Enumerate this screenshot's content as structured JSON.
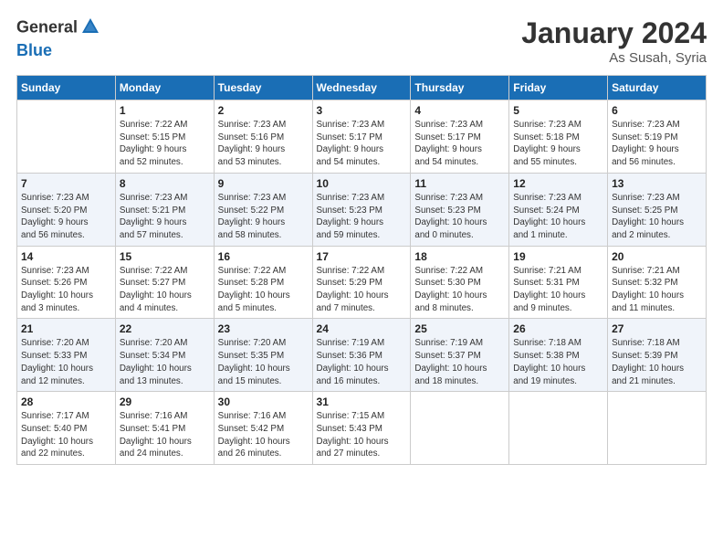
{
  "header": {
    "logo_general": "General",
    "logo_blue": "Blue",
    "month": "January 2024",
    "location": "As Susah, Syria"
  },
  "weekdays": [
    "Sunday",
    "Monday",
    "Tuesday",
    "Wednesday",
    "Thursday",
    "Friday",
    "Saturday"
  ],
  "weeks": [
    [
      {
        "day": "",
        "info": ""
      },
      {
        "day": "1",
        "info": "Sunrise: 7:22 AM\nSunset: 5:15 PM\nDaylight: 9 hours\nand 52 minutes."
      },
      {
        "day": "2",
        "info": "Sunrise: 7:23 AM\nSunset: 5:16 PM\nDaylight: 9 hours\nand 53 minutes."
      },
      {
        "day": "3",
        "info": "Sunrise: 7:23 AM\nSunset: 5:17 PM\nDaylight: 9 hours\nand 54 minutes."
      },
      {
        "day": "4",
        "info": "Sunrise: 7:23 AM\nSunset: 5:17 PM\nDaylight: 9 hours\nand 54 minutes."
      },
      {
        "day": "5",
        "info": "Sunrise: 7:23 AM\nSunset: 5:18 PM\nDaylight: 9 hours\nand 55 minutes."
      },
      {
        "day": "6",
        "info": "Sunrise: 7:23 AM\nSunset: 5:19 PM\nDaylight: 9 hours\nand 56 minutes."
      }
    ],
    [
      {
        "day": "7",
        "info": "Sunrise: 7:23 AM\nSunset: 5:20 PM\nDaylight: 9 hours\nand 56 minutes."
      },
      {
        "day": "8",
        "info": "Sunrise: 7:23 AM\nSunset: 5:21 PM\nDaylight: 9 hours\nand 57 minutes."
      },
      {
        "day": "9",
        "info": "Sunrise: 7:23 AM\nSunset: 5:22 PM\nDaylight: 9 hours\nand 58 minutes."
      },
      {
        "day": "10",
        "info": "Sunrise: 7:23 AM\nSunset: 5:23 PM\nDaylight: 9 hours\nand 59 minutes."
      },
      {
        "day": "11",
        "info": "Sunrise: 7:23 AM\nSunset: 5:23 PM\nDaylight: 10 hours\nand 0 minutes."
      },
      {
        "day": "12",
        "info": "Sunrise: 7:23 AM\nSunset: 5:24 PM\nDaylight: 10 hours\nand 1 minute."
      },
      {
        "day": "13",
        "info": "Sunrise: 7:23 AM\nSunset: 5:25 PM\nDaylight: 10 hours\nand 2 minutes."
      }
    ],
    [
      {
        "day": "14",
        "info": "Sunrise: 7:23 AM\nSunset: 5:26 PM\nDaylight: 10 hours\nand 3 minutes."
      },
      {
        "day": "15",
        "info": "Sunrise: 7:22 AM\nSunset: 5:27 PM\nDaylight: 10 hours\nand 4 minutes."
      },
      {
        "day": "16",
        "info": "Sunrise: 7:22 AM\nSunset: 5:28 PM\nDaylight: 10 hours\nand 5 minutes."
      },
      {
        "day": "17",
        "info": "Sunrise: 7:22 AM\nSunset: 5:29 PM\nDaylight: 10 hours\nand 7 minutes."
      },
      {
        "day": "18",
        "info": "Sunrise: 7:22 AM\nSunset: 5:30 PM\nDaylight: 10 hours\nand 8 minutes."
      },
      {
        "day": "19",
        "info": "Sunrise: 7:21 AM\nSunset: 5:31 PM\nDaylight: 10 hours\nand 9 minutes."
      },
      {
        "day": "20",
        "info": "Sunrise: 7:21 AM\nSunset: 5:32 PM\nDaylight: 10 hours\nand 11 minutes."
      }
    ],
    [
      {
        "day": "21",
        "info": "Sunrise: 7:20 AM\nSunset: 5:33 PM\nDaylight: 10 hours\nand 12 minutes."
      },
      {
        "day": "22",
        "info": "Sunrise: 7:20 AM\nSunset: 5:34 PM\nDaylight: 10 hours\nand 13 minutes."
      },
      {
        "day": "23",
        "info": "Sunrise: 7:20 AM\nSunset: 5:35 PM\nDaylight: 10 hours\nand 15 minutes."
      },
      {
        "day": "24",
        "info": "Sunrise: 7:19 AM\nSunset: 5:36 PM\nDaylight: 10 hours\nand 16 minutes."
      },
      {
        "day": "25",
        "info": "Sunrise: 7:19 AM\nSunset: 5:37 PM\nDaylight: 10 hours\nand 18 minutes."
      },
      {
        "day": "26",
        "info": "Sunrise: 7:18 AM\nSunset: 5:38 PM\nDaylight: 10 hours\nand 19 minutes."
      },
      {
        "day": "27",
        "info": "Sunrise: 7:18 AM\nSunset: 5:39 PM\nDaylight: 10 hours\nand 21 minutes."
      }
    ],
    [
      {
        "day": "28",
        "info": "Sunrise: 7:17 AM\nSunset: 5:40 PM\nDaylight: 10 hours\nand 22 minutes."
      },
      {
        "day": "29",
        "info": "Sunrise: 7:16 AM\nSunset: 5:41 PM\nDaylight: 10 hours\nand 24 minutes."
      },
      {
        "day": "30",
        "info": "Sunrise: 7:16 AM\nSunset: 5:42 PM\nDaylight: 10 hours\nand 26 minutes."
      },
      {
        "day": "31",
        "info": "Sunrise: 7:15 AM\nSunset: 5:43 PM\nDaylight: 10 hours\nand 27 minutes."
      },
      {
        "day": "",
        "info": ""
      },
      {
        "day": "",
        "info": ""
      },
      {
        "day": "",
        "info": ""
      }
    ]
  ]
}
